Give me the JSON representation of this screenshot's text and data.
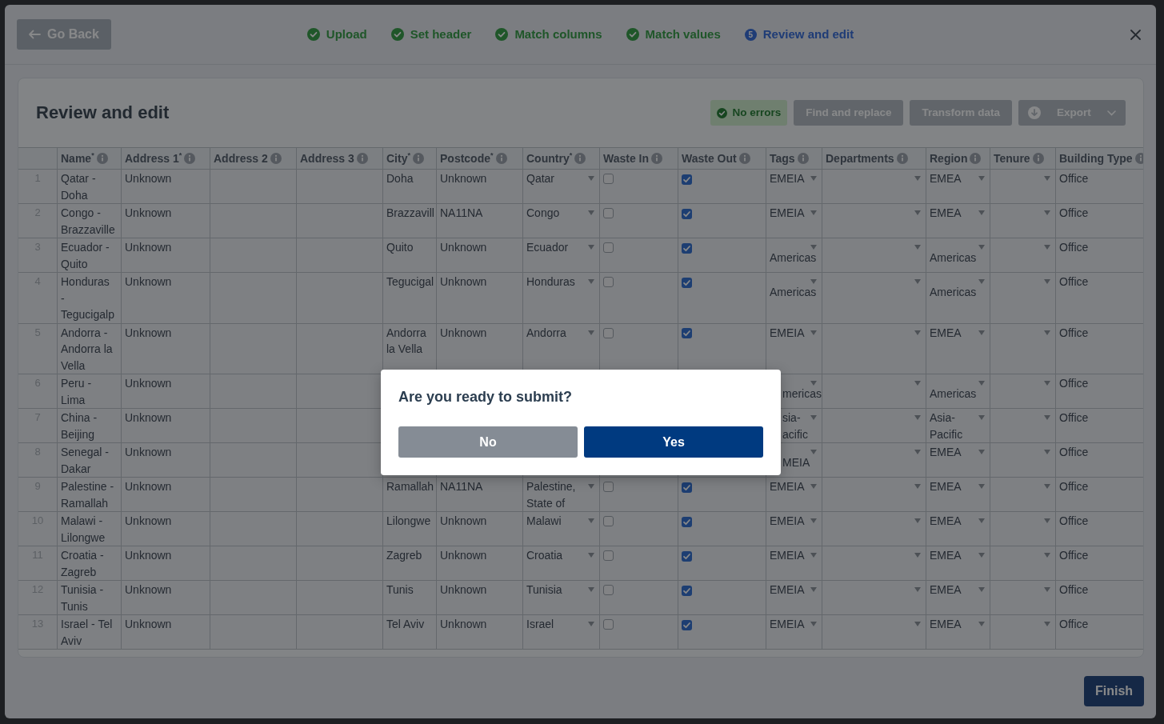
{
  "header": {
    "back_button": "Go Back",
    "steps": [
      {
        "label": "Upload",
        "completed": true,
        "selected": false
      },
      {
        "label": "Set header",
        "completed": true,
        "selected": false
      },
      {
        "label": "Match columns",
        "completed": true,
        "selected": false
      },
      {
        "label": "Match values",
        "completed": true,
        "selected": false
      },
      {
        "label": "Review and edit",
        "completed": false,
        "selected": true,
        "number": "5"
      }
    ]
  },
  "card": {
    "title": "Review and edit",
    "status_badge": "No errors",
    "buttons": [
      {
        "label": "Find and replace",
        "kind": "plain"
      },
      {
        "label": "Transform data",
        "kind": "plain"
      },
      {
        "label": "Export",
        "kind": "export"
      }
    ]
  },
  "table": {
    "columns": [
      {
        "label": "Name$^{*}$",
        "kind": "text"
      },
      {
        "label": "Address 1$^{*}$",
        "kind": "text"
      },
      {
        "label": "Address 2",
        "kind": "text"
      },
      {
        "label": "Address 3",
        "kind": "text"
      },
      {
        "label": "City$^{*}$",
        "kind": "text"
      },
      {
        "label": "Postcode$^{*}$",
        "kind": "text"
      },
      {
        "label": "Country$^{*}$",
        "kind": "select"
      },
      {
        "label": "Waste In",
        "kind": "checkbox"
      },
      {
        "label": "Waste Out",
        "kind": "checkbox"
      },
      {
        "label": "Tags",
        "kind": "select"
      },
      {
        "label": "Departments",
        "kind": "select"
      },
      {
        "label": "Region",
        "kind": "select"
      },
      {
        "label": "Tenure",
        "kind": "select"
      },
      {
        "label": "Building Type",
        "kind": "text"
      }
    ],
    "rows": [
      {
        "number": "1",
        "cells": [
          "Qatar - Doha",
          "Unknown",
          null,
          null,
          "Doha",
          "Unknown",
          "Qatar",
          {
            "checked": false
          },
          {
            "checked": true
          },
          "EMEIA",
          {},
          "EMEA",
          {},
          "Office"
        ]
      },
      {
        "number": "2",
        "cells": [
          "Congo - Brazzaville",
          "Unknown",
          null,
          null,
          "Brazzavill",
          "NA11NA",
          "Congo",
          {
            "checked": false
          },
          {
            "checked": true
          },
          "EMEIA",
          {},
          "EMEA",
          {},
          "Office"
        ]
      },
      {
        "number": "3",
        "cells": [
          "Ecuador - Quito",
          "Unknown",
          null,
          null,
          "Quito",
          "Unknown",
          "Ecuador",
          {
            "checked": false
          },
          {
            "checked": true
          },
          "Americas",
          {},
          "Americas",
          {},
          "Office"
        ]
      },
      {
        "number": "4",
        "cells": [
          "Honduras - Tegucigalp",
          "Unknown",
          null,
          null,
          "Tegucigal",
          "Unknown",
          "Honduras",
          {
            "checked": false
          },
          {
            "checked": true
          },
          "Americas",
          {},
          "Americas",
          {},
          "Office"
        ]
      },
      {
        "number": "5",
        "cells": [
          "Andorra - Andorra la Vella",
          "Unknown",
          null,
          null,
          "Andorra la Vella",
          "Unknown",
          "Andorra",
          {
            "checked": false
          },
          {
            "checked": true
          },
          "EMEIA",
          {},
          "EMEA",
          {},
          "Office"
        ]
      },
      {
        "number": "6",
        "cells": [
          "Peru - Lima",
          "Unknown",
          null,
          null,
          null,
          null,
          null,
          null,
          null,
          {
            "value": "mericas",
            "clipped": true
          },
          {},
          "Americas",
          {},
          "Office"
        ]
      },
      {
        "number": "7",
        "cells": [
          "China - Beijing",
          "Unknown",
          null,
          null,
          null,
          null,
          null,
          null,
          null,
          {
            "value": "sia-acific",
            "clipped": true
          },
          {},
          "Asia-Pacific",
          {},
          "Office"
        ]
      },
      {
        "number": "8",
        "cells": [
          "Senegal - Dakar",
          "Unknown",
          null,
          null,
          null,
          null,
          null,
          null,
          null,
          {
            "value": "MEIA",
            "clipped": true
          },
          {},
          "EMEA",
          {},
          "Office"
        ]
      },
      {
        "number": "9",
        "cells": [
          "Palestine - Ramallah",
          "Unknown",
          null,
          null,
          "Ramallah",
          "NA11NA",
          "Palestine, State of",
          {
            "checked": false
          },
          {
            "checked": true
          },
          "EMEIA",
          {},
          "EMEA",
          {},
          "Office"
        ]
      },
      {
        "number": "10",
        "cells": [
          "Malawi - Lilongwe",
          "Unknown",
          null,
          null,
          "Lilongwe",
          "Unknown",
          "Malawi",
          {
            "checked": false
          },
          {
            "checked": true
          },
          "EMEIA",
          {},
          "EMEA",
          {},
          "Office"
        ]
      },
      {
        "number": "11",
        "cells": [
          "Croatia - Zagreb",
          "Unknown",
          null,
          null,
          "Zagreb",
          "Unknown",
          "Croatia",
          {
            "checked": false
          },
          {
            "checked": true
          },
          "EMEIA",
          {},
          "EMEA",
          {},
          "Office"
        ]
      },
      {
        "number": "12",
        "cells": [
          "Tunisia - Tunis",
          "Unknown",
          null,
          null,
          "Tunis",
          "Unknown",
          "Tunisia",
          {
            "checked": false
          },
          {
            "checked": true
          },
          "EMEIA",
          {},
          "EMEA",
          {},
          "Office"
        ]
      },
      {
        "number": "13",
        "cells": [
          "Israel - Tel Aviv",
          "Unknown",
          null,
          null,
          "Tel Aviv",
          "Unknown",
          "Israel",
          {
            "checked": false
          },
          {
            "checked": true
          },
          "EMEIA",
          {},
          "EMEA",
          {},
          "Office"
        ]
      }
    ]
  },
  "footer": {
    "finish_button": "Finish"
  },
  "dialog": {
    "title": "Are you ready to submit?",
    "buttons": [
      {
        "label": "No",
        "kind": "secondary"
      },
      {
        "label": "Yes",
        "kind": "primary"
      }
    ]
  }
}
